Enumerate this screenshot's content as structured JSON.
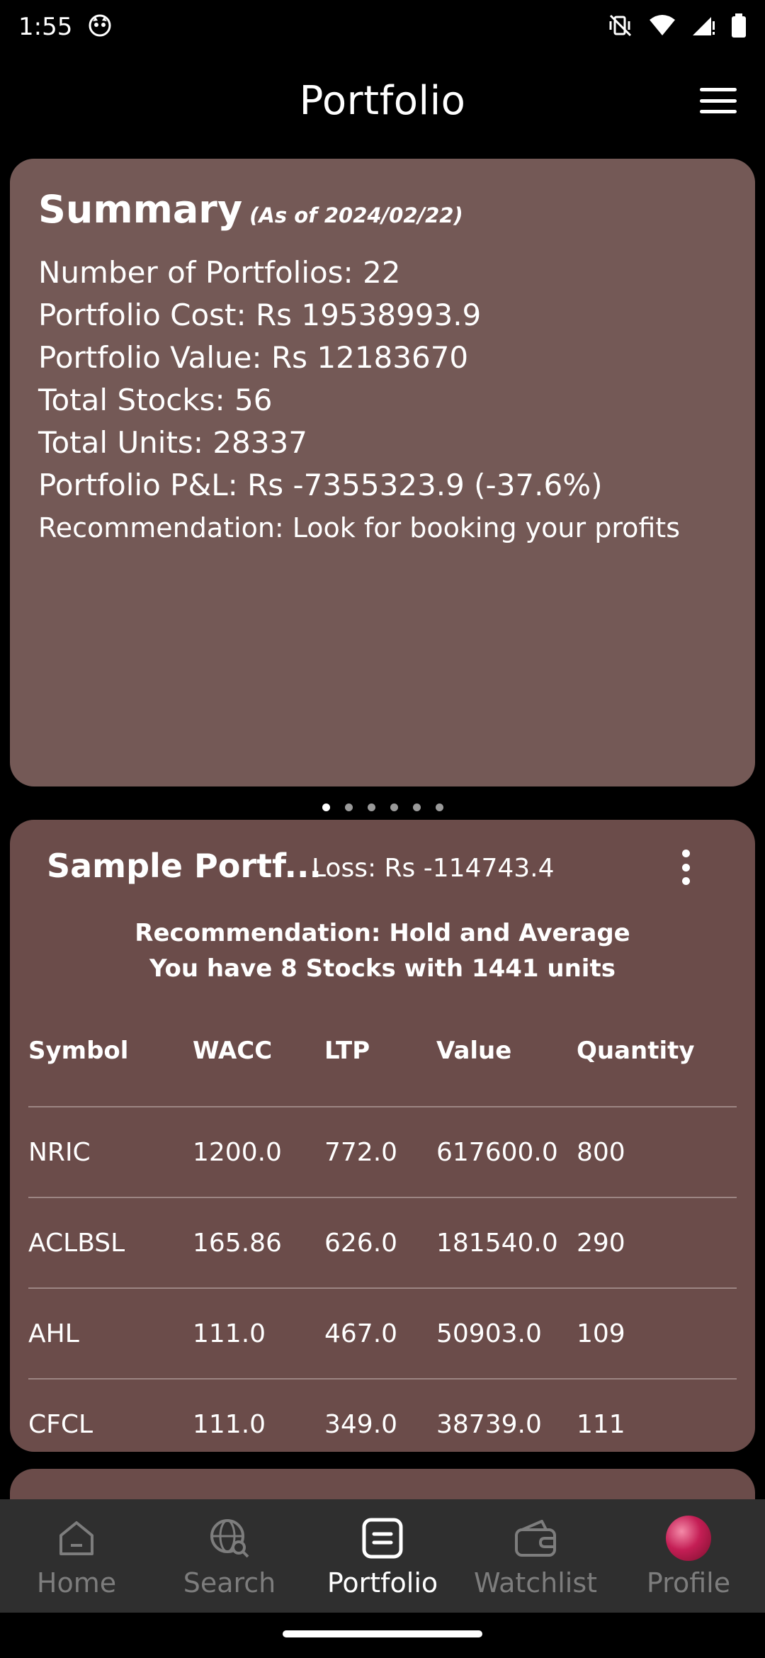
{
  "status_bar": {
    "time": "1:55"
  },
  "app_bar": {
    "title": "Portfolio"
  },
  "summary": {
    "title": "Summary",
    "as_of": "(As of 2024/02/22)",
    "lines": [
      "Number of Portfolios:  22",
      "Portfolio Cost: Rs 19538993.9",
      "Portfolio Value: Rs  12183670",
      "Total Stocks: 56",
      "Total Units:  28337",
      "Portfolio P&L: Rs -7355323.9 (-37.6%)"
    ],
    "recommendation": "Recommendation:  Look for booking your profits"
  },
  "pager": {
    "count": 6,
    "active_index": 0
  },
  "portfolio_card": {
    "name": "Sample Portf...",
    "loss": "Loss: Rs -114743.4",
    "recommendation": "Recommendation:  Hold and Average",
    "stocks_summary": "You have 8 Stocks with 1441 units",
    "columns": [
      "Symbol",
      "WACC",
      "LTP",
      "Value",
      "Quantity"
    ],
    "rows": [
      [
        "NRIC",
        "1200.0",
        "772.0",
        "617600.0",
        "800"
      ],
      [
        "ACLBSL",
        "165.86",
        "626.0",
        "181540.0",
        "290"
      ],
      [
        "AHL",
        "111.0",
        "467.0",
        "50903.0",
        "109"
      ],
      [
        "CFCL",
        "111.0",
        "349.0",
        "38739.0",
        "111"
      ]
    ]
  },
  "bottom_nav": {
    "items": [
      {
        "label": "Home",
        "icon": "home-icon"
      },
      {
        "label": "Search",
        "icon": "globe-search-icon"
      },
      {
        "label": "Portfolio",
        "icon": "portfolio-icon"
      },
      {
        "label": "Watchlist",
        "icon": "wallet-icon"
      },
      {
        "label": "Profile",
        "icon": "avatar"
      }
    ],
    "active": "Portfolio"
  },
  "colors": {
    "summary_card": "#745956",
    "portfolio_card": "#6b4c4a",
    "nav_bg": "#2f2f2f"
  }
}
